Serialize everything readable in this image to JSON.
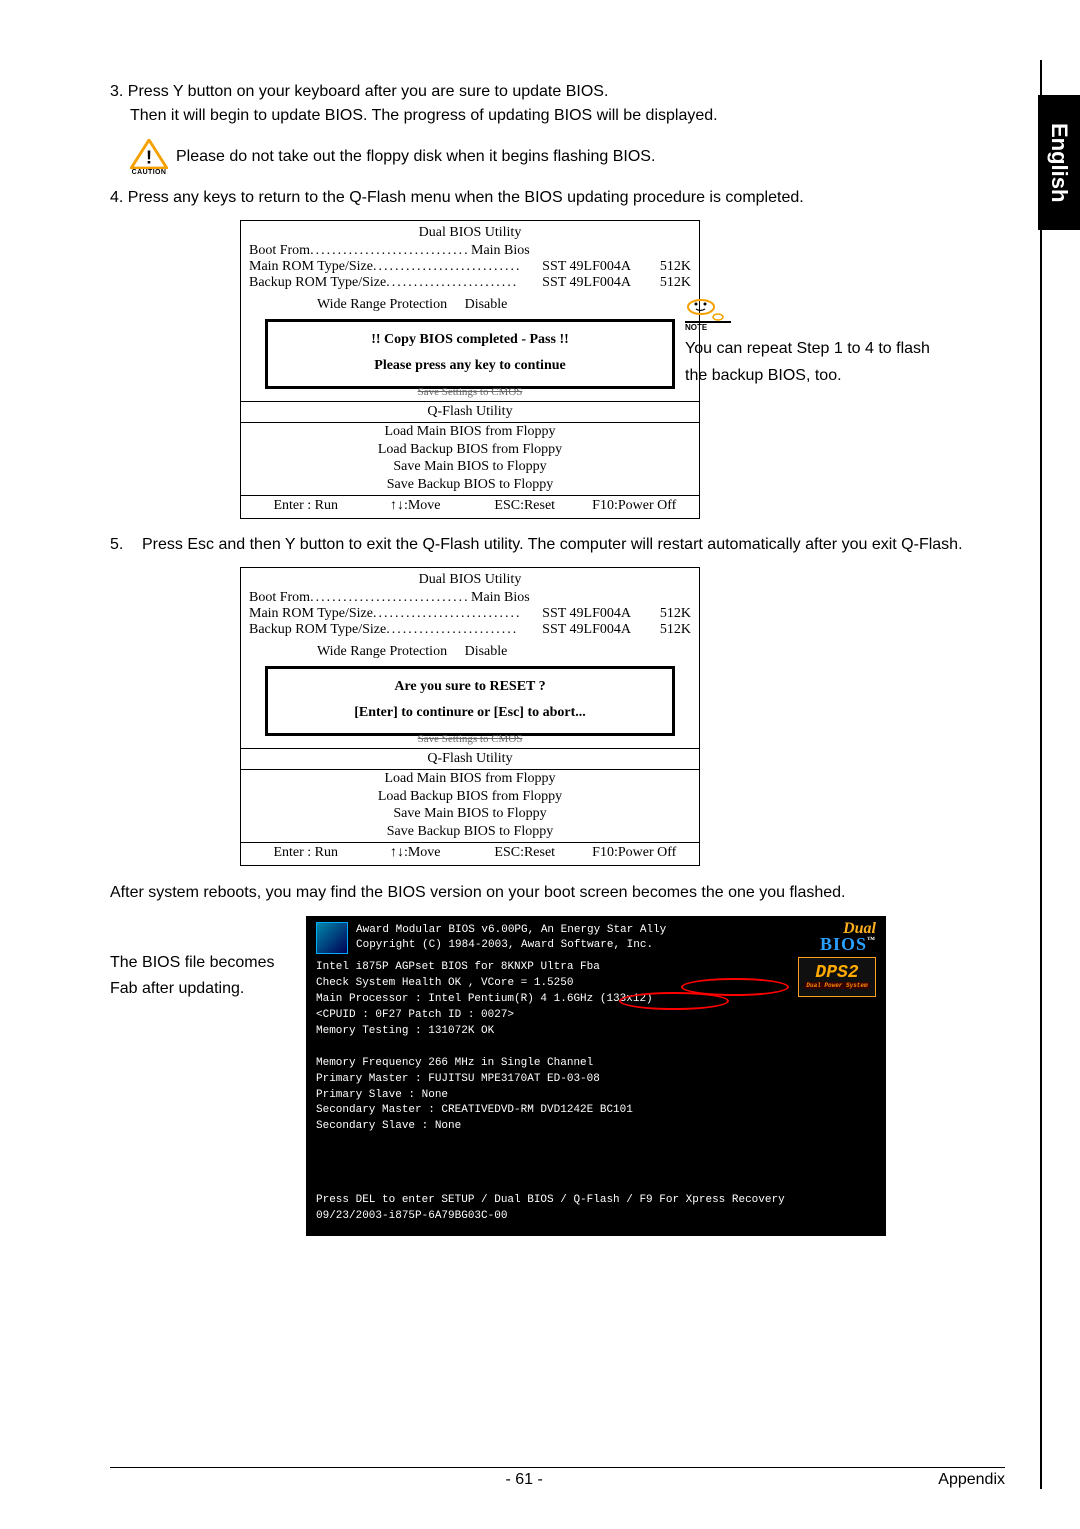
{
  "lang_tab": "English",
  "step3": {
    "num": "3.",
    "line1": "Press Y button on your keyboard after you are sure to update BIOS.",
    "line2": "Then it will begin to update BIOS. The progress of updating BIOS will be displayed."
  },
  "caution": {
    "label": "CAUTION",
    "text": "Please do not take out the floppy disk when it begins flashing BIOS."
  },
  "step4": "4. Press any keys to return to the Q-Flash menu when the BIOS updating procedure is completed.",
  "bios_common": {
    "title": "Dual BIOS Utility",
    "boot_from_label": "Boot From",
    "boot_from_value": "Main Bios",
    "main_rom_label": "Main ROM Type/Size",
    "main_rom_value": "SST 49LF004A",
    "main_rom_size": "512K",
    "backup_rom_label": "Backup ROM Type/Size",
    "backup_rom_value": "SST 49LF004A",
    "backup_rom_size": "512K",
    "wrp_label": "Wide Range Protection",
    "wrp_value": "Disable",
    "blur": "Save Settings to CMOS",
    "qflash_title": "Q-Flash Utility",
    "menu": [
      "Load Main BIOS from Floppy",
      "Load Backup BIOS from Floppy",
      "Save Main BIOS to Floppy",
      "Save Backup BIOS to Floppy"
    ],
    "foot": {
      "run": "Enter : Run",
      "move": "↑↓:Move",
      "reset": "ESC:Reset",
      "power": "F10:Power Off"
    }
  },
  "bios1_msg": {
    "title": "!! Copy BIOS completed - Pass !!",
    "body": "Please press any key to continue"
  },
  "note1": {
    "label": "NOTE",
    "text": "You can repeat Step 1 to 4 to flash the backup BIOS, too."
  },
  "step5": {
    "num": "5.",
    "text": "Press Esc and then Y button to exit the Q-Flash utility. The computer will restart automatically after you exit Q-Flash."
  },
  "bios2_msg": {
    "title": "Are you sure to RESET ?",
    "body": "[Enter] to continure or [Esc] to abort..."
  },
  "after_reboot": "After system reboots, you may find the BIOS version on your boot screen becomes the one you flashed.",
  "boot_note": "The BIOS file becomes Fab after updating.",
  "boot": {
    "hdr1": "Award Modular BIOS v6.00PG, An Energy Star Ally",
    "hdr2": "Copyright (C) 1984-2003, Award Software, Inc.",
    "line1a": "Intel i875P AGPset BIOS for",
    "line1b": "8KNXP Ultra Fba",
    "line2a": "Check System Health OK ,",
    "line2b": "VCore = 1.5250",
    "line3": "Main Processor : Intel Pentium(R) 4  1.6GHz (133x12)",
    "line4": "<CPUID : 0F27 Patch ID  : 0027>",
    "line5": "Memory Testing  : 131072K OK",
    "line7": "Memory Frequency 266 MHz in Single Channel",
    "line8": "Primary Master : FUJITSU MPE3170AT ED-03-08",
    "line9": "Primary Slave : None",
    "line10": "Secondary Master : CREATIVEDVD-RM DVD1242E BC101",
    "line11": "Secondary Slave : None",
    "f1": "Press DEL to enter SETUP / Dual BIOS / Q-Flash / F9 For Xpress Recovery",
    "f2": "09/23/2003-i875P-6A79BG03C-00",
    "dual_top": "Dual",
    "dual_bot": "BIOS",
    "dps_top": "DPS2",
    "dps_sub": "Dual Power System"
  },
  "footer": {
    "page": "- 61 -",
    "section": "Appendix"
  }
}
